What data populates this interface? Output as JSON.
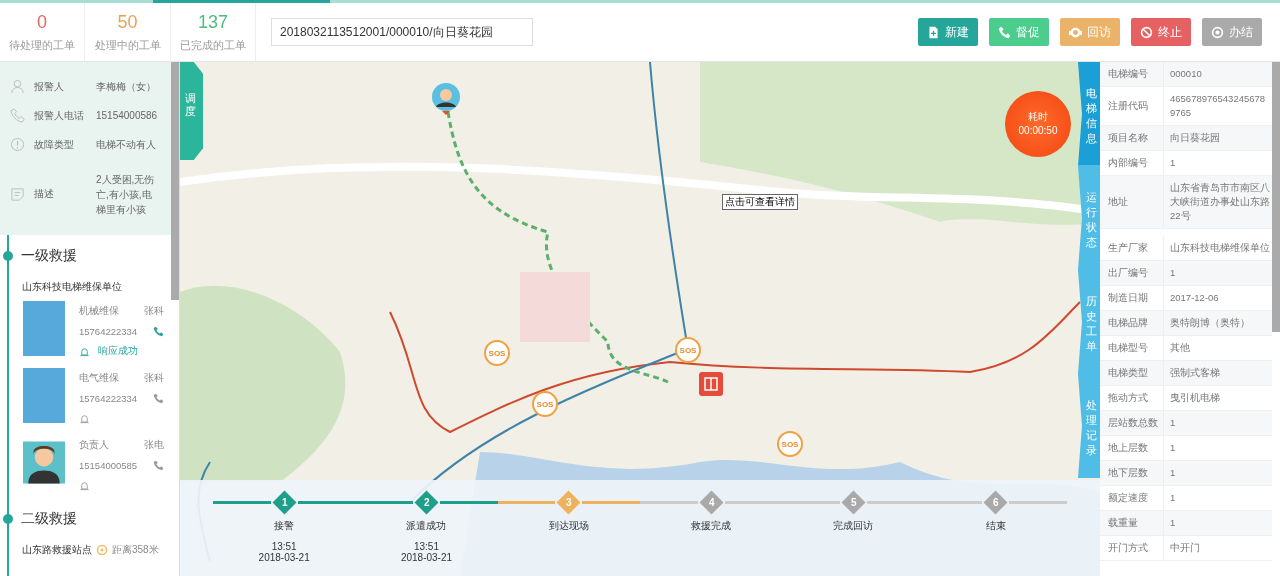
{
  "stats": [
    {
      "value": "0",
      "label": "待处理的工单",
      "color": "#e06a5e"
    },
    {
      "value": "50",
      "label": "处理中的工单",
      "color": "#e9a35a"
    },
    {
      "value": "137",
      "label": "已完成的工单",
      "color": "#4bbd7e"
    }
  ],
  "search": {
    "value": "2018032113512001/000010/向日葵花园"
  },
  "actions": [
    {
      "label": "新建",
      "kind": "new",
      "color": "#26a69a"
    },
    {
      "label": "督促",
      "kind": "phone",
      "color": "#4ccc8d"
    },
    {
      "label": "回访",
      "kind": "visit",
      "color": "#ebb36a"
    },
    {
      "label": "终止",
      "kind": "stop",
      "color": "#e66262"
    },
    {
      "label": "办结",
      "kind": "finish",
      "color": "#aaaaaa"
    }
  ],
  "report": [
    {
      "kind": "person",
      "label": "报警人",
      "value": "李梅梅（女）"
    },
    {
      "kind": "phone",
      "label": "报警人电话",
      "value": "15154000586"
    },
    {
      "kind": "alert",
      "label": "故障类型",
      "value": "电梯不动有人"
    },
    {
      "kind": "note",
      "label": "描述",
      "value": "2人受困,无伤亡,有小孩,电梯里有小孩"
    }
  ],
  "rescue": [
    {
      "title": "一级救援",
      "unit": "山东科技电梯维保单位",
      "staff": [
        {
          "kind": "photo",
          "role": "机械维保",
          "name": "张科",
          "phone": "15764222334",
          "active": true,
          "status": "响应成功"
        },
        {
          "kind": "photo",
          "role": "电气维保",
          "name": "张科",
          "phone": "15764222334",
          "active": false
        },
        {
          "kind": "cartoon",
          "role": "负责人",
          "name": "张电",
          "phone": "15154000585",
          "active": false
        }
      ]
    },
    {
      "title": "二级救援",
      "unit": "山东路救援站点",
      "distance": "距离358米"
    }
  ],
  "map": {
    "dispatch_tab": "调度",
    "timer": {
      "label": "耗时",
      "value": "00:00:50"
    },
    "tooltip": "点击可查看详情",
    "sos": [
      {
        "label": "SOS"
      },
      {
        "label": "SOS"
      },
      {
        "label": "SOS"
      },
      {
        "label": "SOS"
      }
    ]
  },
  "side_tabs": [
    {
      "label": "电梯信息",
      "selected": true
    },
    {
      "label": "运行状态",
      "selected": false
    },
    {
      "label": "历史工单",
      "selected": false
    },
    {
      "label": "处理记录",
      "selected": false
    }
  ],
  "progress": [
    {
      "number": "1",
      "label": "接警",
      "time": "13:51",
      "date": "2018-03-21",
      "kind": "done"
    },
    {
      "number": "2",
      "label": "派遣成功",
      "time": "13:51",
      "date": "2018-03-21",
      "kind": "done"
    },
    {
      "number": "3",
      "label": "到达现场",
      "kind": "current"
    },
    {
      "number": "4",
      "label": "救援完成",
      "kind": "pending"
    },
    {
      "number": "5",
      "label": "完成回访",
      "kind": "pending"
    },
    {
      "number": "6",
      "label": "结束",
      "kind": "pending"
    }
  ],
  "elevator_info": [
    {
      "label": "电梯编号",
      "value": "000010"
    },
    {
      "label": "注册代码",
      "value": "4656789765432456789765"
    },
    {
      "label": "项目名称",
      "value": "向日葵花园"
    },
    {
      "label": "内部编号",
      "value": "1"
    },
    {
      "label": "地址",
      "value": "山东省青岛市市南区八大峡街道办事处山东路22号"
    },
    {
      "label": "生产厂家",
      "value": "山东科技电梯维保单位"
    },
    {
      "label": "出厂编号",
      "value": "1"
    },
    {
      "label": "制造日期",
      "value": "2017-12-06"
    },
    {
      "label": "电梯品牌",
      "value": "奥特朗博（奥特）"
    },
    {
      "label": "电梯型号",
      "value": "其他"
    },
    {
      "label": "电梯类型",
      "value": "强制式客梯"
    },
    {
      "label": "拖动方式",
      "value": "曳引机电梯"
    },
    {
      "label": "层站数总数",
      "value": "1"
    },
    {
      "label": "地上层数",
      "value": "1"
    },
    {
      "label": "地下层数",
      "value": "1"
    },
    {
      "label": "额定速度",
      "value": "1"
    },
    {
      "label": "载重量",
      "value": "1"
    },
    {
      "label": "开门方式",
      "value": "中开门"
    }
  ]
}
